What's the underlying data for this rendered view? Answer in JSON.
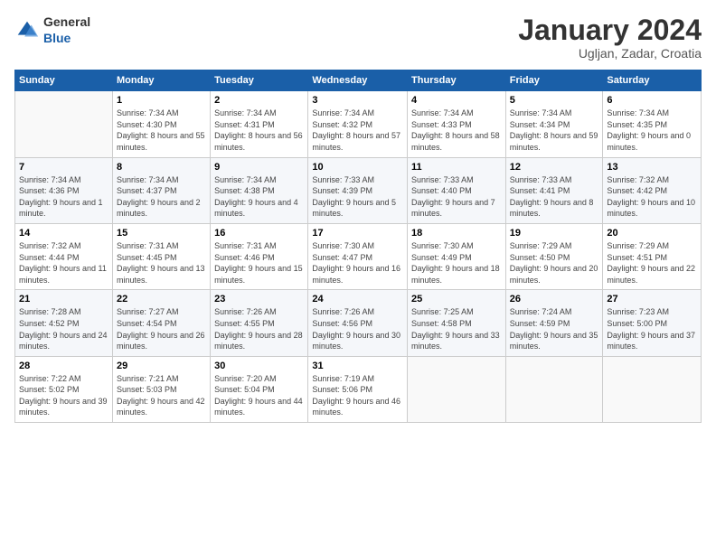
{
  "logo": {
    "general": "General",
    "blue": "Blue"
  },
  "title": "January 2024",
  "location": "Ugljan, Zadar, Croatia",
  "weekdays": [
    "Sunday",
    "Monday",
    "Tuesday",
    "Wednesday",
    "Thursday",
    "Friday",
    "Saturday"
  ],
  "weeks": [
    [
      {
        "day": "",
        "sunrise": "",
        "sunset": "",
        "daylight": ""
      },
      {
        "day": "1",
        "sunrise": "Sunrise: 7:34 AM",
        "sunset": "Sunset: 4:30 PM",
        "daylight": "Daylight: 8 hours and 55 minutes."
      },
      {
        "day": "2",
        "sunrise": "Sunrise: 7:34 AM",
        "sunset": "Sunset: 4:31 PM",
        "daylight": "Daylight: 8 hours and 56 minutes."
      },
      {
        "day": "3",
        "sunrise": "Sunrise: 7:34 AM",
        "sunset": "Sunset: 4:32 PM",
        "daylight": "Daylight: 8 hours and 57 minutes."
      },
      {
        "day": "4",
        "sunrise": "Sunrise: 7:34 AM",
        "sunset": "Sunset: 4:33 PM",
        "daylight": "Daylight: 8 hours and 58 minutes."
      },
      {
        "day": "5",
        "sunrise": "Sunrise: 7:34 AM",
        "sunset": "Sunset: 4:34 PM",
        "daylight": "Daylight: 8 hours and 59 minutes."
      },
      {
        "day": "6",
        "sunrise": "Sunrise: 7:34 AM",
        "sunset": "Sunset: 4:35 PM",
        "daylight": "Daylight: 9 hours and 0 minutes."
      }
    ],
    [
      {
        "day": "7",
        "sunrise": "Sunrise: 7:34 AM",
        "sunset": "Sunset: 4:36 PM",
        "daylight": "Daylight: 9 hours and 1 minute."
      },
      {
        "day": "8",
        "sunrise": "Sunrise: 7:34 AM",
        "sunset": "Sunset: 4:37 PM",
        "daylight": "Daylight: 9 hours and 2 minutes."
      },
      {
        "day": "9",
        "sunrise": "Sunrise: 7:34 AM",
        "sunset": "Sunset: 4:38 PM",
        "daylight": "Daylight: 9 hours and 4 minutes."
      },
      {
        "day": "10",
        "sunrise": "Sunrise: 7:33 AM",
        "sunset": "Sunset: 4:39 PM",
        "daylight": "Daylight: 9 hours and 5 minutes."
      },
      {
        "day": "11",
        "sunrise": "Sunrise: 7:33 AM",
        "sunset": "Sunset: 4:40 PM",
        "daylight": "Daylight: 9 hours and 7 minutes."
      },
      {
        "day": "12",
        "sunrise": "Sunrise: 7:33 AM",
        "sunset": "Sunset: 4:41 PM",
        "daylight": "Daylight: 9 hours and 8 minutes."
      },
      {
        "day": "13",
        "sunrise": "Sunrise: 7:32 AM",
        "sunset": "Sunset: 4:42 PM",
        "daylight": "Daylight: 9 hours and 10 minutes."
      }
    ],
    [
      {
        "day": "14",
        "sunrise": "Sunrise: 7:32 AM",
        "sunset": "Sunset: 4:44 PM",
        "daylight": "Daylight: 9 hours and 11 minutes."
      },
      {
        "day": "15",
        "sunrise": "Sunrise: 7:31 AM",
        "sunset": "Sunset: 4:45 PM",
        "daylight": "Daylight: 9 hours and 13 minutes."
      },
      {
        "day": "16",
        "sunrise": "Sunrise: 7:31 AM",
        "sunset": "Sunset: 4:46 PM",
        "daylight": "Daylight: 9 hours and 15 minutes."
      },
      {
        "day": "17",
        "sunrise": "Sunrise: 7:30 AM",
        "sunset": "Sunset: 4:47 PM",
        "daylight": "Daylight: 9 hours and 16 minutes."
      },
      {
        "day": "18",
        "sunrise": "Sunrise: 7:30 AM",
        "sunset": "Sunset: 4:49 PM",
        "daylight": "Daylight: 9 hours and 18 minutes."
      },
      {
        "day": "19",
        "sunrise": "Sunrise: 7:29 AM",
        "sunset": "Sunset: 4:50 PM",
        "daylight": "Daylight: 9 hours and 20 minutes."
      },
      {
        "day": "20",
        "sunrise": "Sunrise: 7:29 AM",
        "sunset": "Sunset: 4:51 PM",
        "daylight": "Daylight: 9 hours and 22 minutes."
      }
    ],
    [
      {
        "day": "21",
        "sunrise": "Sunrise: 7:28 AM",
        "sunset": "Sunset: 4:52 PM",
        "daylight": "Daylight: 9 hours and 24 minutes."
      },
      {
        "day": "22",
        "sunrise": "Sunrise: 7:27 AM",
        "sunset": "Sunset: 4:54 PM",
        "daylight": "Daylight: 9 hours and 26 minutes."
      },
      {
        "day": "23",
        "sunrise": "Sunrise: 7:26 AM",
        "sunset": "Sunset: 4:55 PM",
        "daylight": "Daylight: 9 hours and 28 minutes."
      },
      {
        "day": "24",
        "sunrise": "Sunrise: 7:26 AM",
        "sunset": "Sunset: 4:56 PM",
        "daylight": "Daylight: 9 hours and 30 minutes."
      },
      {
        "day": "25",
        "sunrise": "Sunrise: 7:25 AM",
        "sunset": "Sunset: 4:58 PM",
        "daylight": "Daylight: 9 hours and 33 minutes."
      },
      {
        "day": "26",
        "sunrise": "Sunrise: 7:24 AM",
        "sunset": "Sunset: 4:59 PM",
        "daylight": "Daylight: 9 hours and 35 minutes."
      },
      {
        "day": "27",
        "sunrise": "Sunrise: 7:23 AM",
        "sunset": "Sunset: 5:00 PM",
        "daylight": "Daylight: 9 hours and 37 minutes."
      }
    ],
    [
      {
        "day": "28",
        "sunrise": "Sunrise: 7:22 AM",
        "sunset": "Sunset: 5:02 PM",
        "daylight": "Daylight: 9 hours and 39 minutes."
      },
      {
        "day": "29",
        "sunrise": "Sunrise: 7:21 AM",
        "sunset": "Sunset: 5:03 PM",
        "daylight": "Daylight: 9 hours and 42 minutes."
      },
      {
        "day": "30",
        "sunrise": "Sunrise: 7:20 AM",
        "sunset": "Sunset: 5:04 PM",
        "daylight": "Daylight: 9 hours and 44 minutes."
      },
      {
        "day": "31",
        "sunrise": "Sunrise: 7:19 AM",
        "sunset": "Sunset: 5:06 PM",
        "daylight": "Daylight: 9 hours and 46 minutes."
      },
      {
        "day": "",
        "sunrise": "",
        "sunset": "",
        "daylight": ""
      },
      {
        "day": "",
        "sunrise": "",
        "sunset": "",
        "daylight": ""
      },
      {
        "day": "",
        "sunrise": "",
        "sunset": "",
        "daylight": ""
      }
    ]
  ]
}
